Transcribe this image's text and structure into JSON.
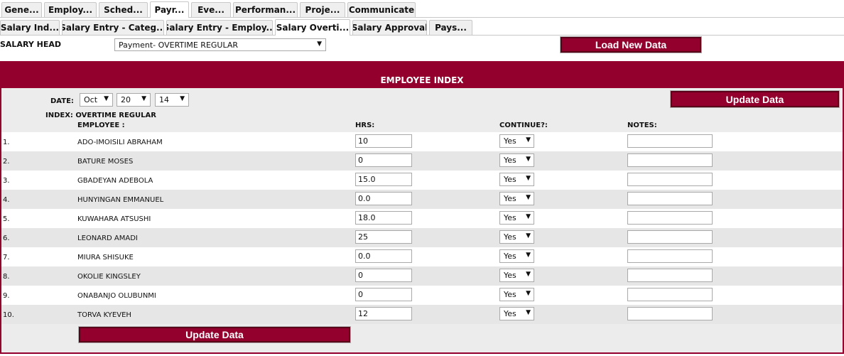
{
  "tabs_row1": [
    {
      "label": "Gene...",
      "active": false
    },
    {
      "label": "Employ...",
      "active": false
    },
    {
      "label": "Sched...",
      "active": false
    },
    {
      "label": "Payr...",
      "active": true
    },
    {
      "label": "Eve...",
      "active": false
    },
    {
      "label": "Performan...",
      "active": false
    },
    {
      "label": "Proje...",
      "active": false
    },
    {
      "label": "Communicate",
      "active": false
    }
  ],
  "tabs_row2": [
    {
      "label": "Salary Ind...",
      "active": false
    },
    {
      "label": "Salary Entry - Categ...",
      "active": false
    },
    {
      "label": "Salary Entry - Employ...",
      "active": false
    },
    {
      "label": "Salary Overti...",
      "active": true
    },
    {
      "label": "Salary Approval",
      "active": false
    },
    {
      "label": "Pays...",
      "active": false
    }
  ],
  "salary_head": {
    "label": "SALARY HEAD",
    "selected": "Payment- OVERTIME REGULAR"
  },
  "load_button": "Load New Data",
  "panel": {
    "title": "EMPLOYEE INDEX",
    "date_label": "DATE:",
    "date_month": "Oct",
    "date_day": "20",
    "date_year": "14",
    "update_top": "Update Data",
    "index_label": "INDEX: OVERTIME REGULAR",
    "col_employee": "EMPLOYEE :",
    "col_hrs": "HRS:",
    "col_continue": "CONTINUE?:",
    "col_notes": "NOTES:",
    "update_bottom": "Update Data"
  },
  "employees": [
    {
      "num": "1.",
      "name": "ADO-IMOISILI ABRAHAM",
      "hrs": "10",
      "continue": "Yes",
      "notes": ""
    },
    {
      "num": "2.",
      "name": "BATURE MOSES",
      "hrs": "0",
      "continue": "Yes",
      "notes": ""
    },
    {
      "num": "3.",
      "name": "GBADEYAN ADEBOLA",
      "hrs": "15.0",
      "continue": "Yes",
      "notes": ""
    },
    {
      "num": "4.",
      "name": "HUNYINGAN EMMANUEL",
      "hrs": "0.0",
      "continue": "Yes",
      "notes": ""
    },
    {
      "num": "5.",
      "name": "KUWAHARA ATSUSHI",
      "hrs": "18.0",
      "continue": "Yes",
      "notes": ""
    },
    {
      "num": "6.",
      "name": "LEONARD AMADI",
      "hrs": "25",
      "continue": "Yes",
      "notes": ""
    },
    {
      "num": "7.",
      "name": "MIURA SHISUKE",
      "hrs": "0.0",
      "continue": "Yes",
      "notes": ""
    },
    {
      "num": "8.",
      "name": "OKOLIE KINGSLEY",
      "hrs": "0",
      "continue": "Yes",
      "notes": ""
    },
    {
      "num": "9.",
      "name": "ONABANJO OLUBUNMI",
      "hrs": "0",
      "continue": "Yes",
      "notes": ""
    },
    {
      "num": "10.",
      "name": "TORVA KYEVEH",
      "hrs": "12",
      "continue": "Yes",
      "notes": ""
    }
  ],
  "icons": {
    "dropdown_arrow": "▼"
  },
  "colors": {
    "accent": "#94002e",
    "panel_bg": "#ececec",
    "row_alt": "#e6e6e6"
  }
}
